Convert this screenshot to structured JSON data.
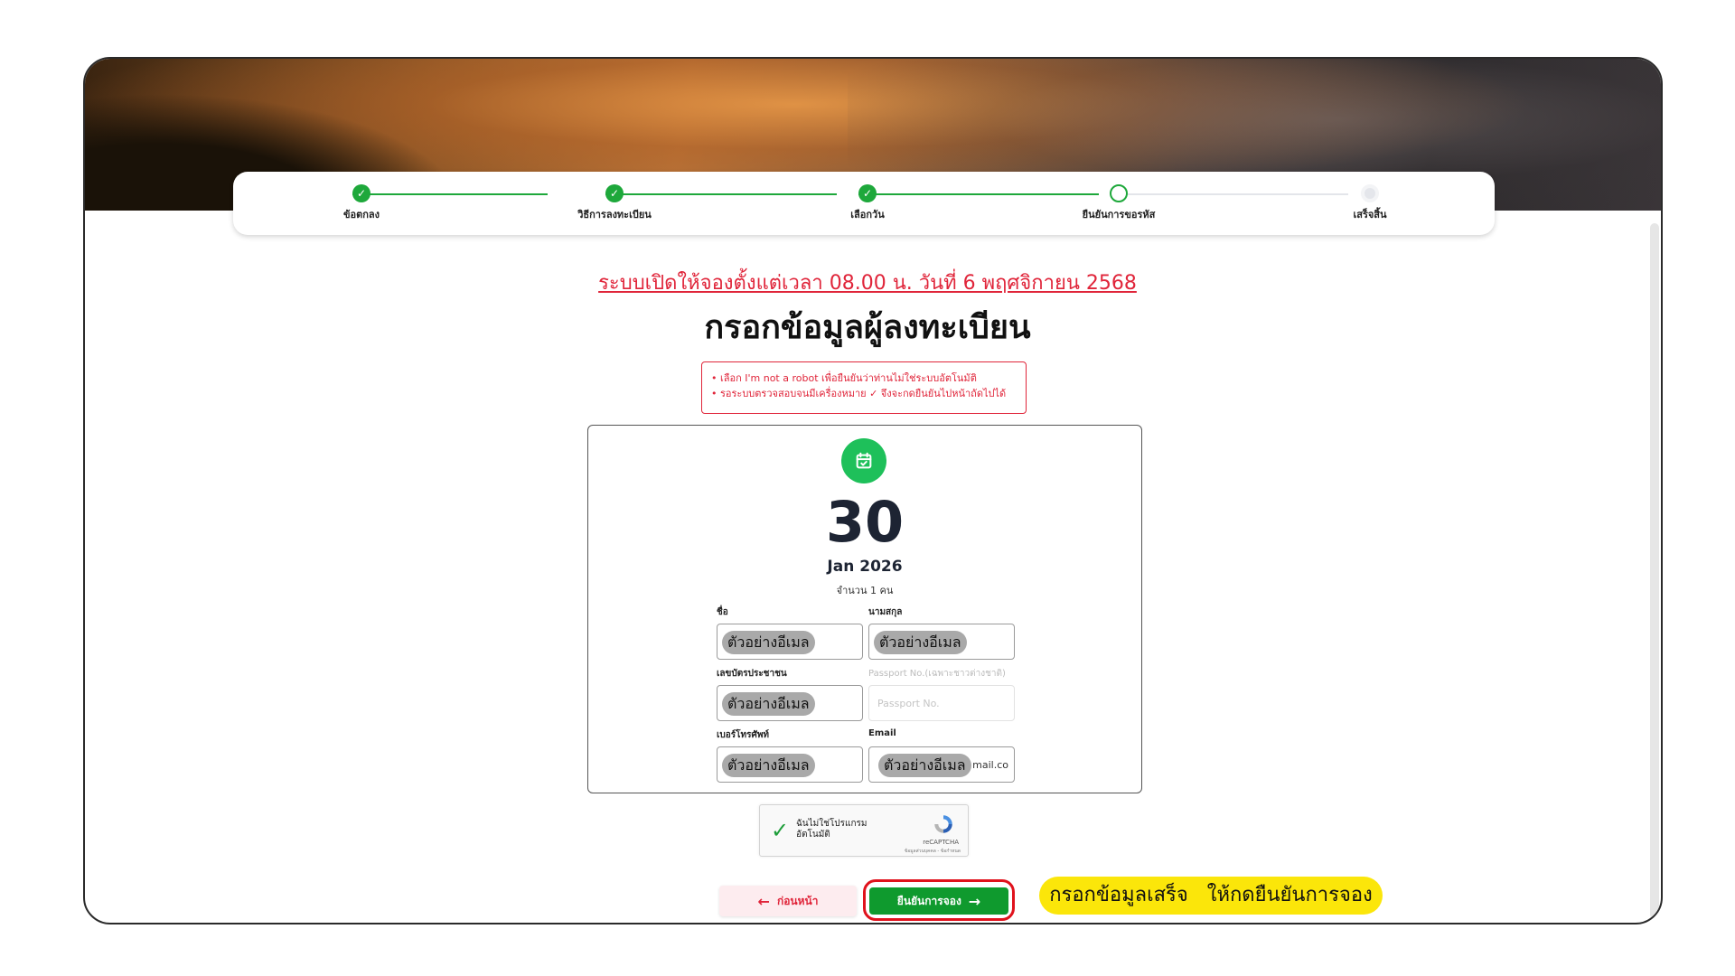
{
  "stepper": {
    "steps": [
      {
        "label": "ข้อตกลง",
        "status": "done"
      },
      {
        "label": "วิธีการลงทะเบียน",
        "status": "done"
      },
      {
        "label": "เลือกวัน",
        "status": "done"
      },
      {
        "label": "ยืนยันการขอรหัส",
        "status": "current"
      },
      {
        "label": "เสร็จสิ้น",
        "status": "pending"
      }
    ]
  },
  "notice": "ระบบเปิดให้จองตั้งแต่เวลา 08.00 น. วันที่ 6 พฤศจิกายน 2568",
  "title": "กรอกข้อมูลผู้ลงทะเบียน",
  "warnings": [
    "• เลือก I'm not a robot เพื่อยืนยันว่าท่านไม่ใช่ระบบอัตโนมัติ",
    "• รอระบบตรวจสอบจนมีเครื่องหมาย ✓ จึงจะกดยืนยันไปหน้าถัดไปได้"
  ],
  "booking": {
    "day": "30",
    "month_year": "Jan 2026",
    "count": "จำนวน 1 คน"
  },
  "form": {
    "first_name": {
      "label": "ชื่อ",
      "value": "ตัวอย่างอีเมล"
    },
    "last_name": {
      "label": "นามสกุล",
      "value": "ตัวอย่างอีเมล"
    },
    "id_card": {
      "label": "เลขบัตรประชาชน",
      "value": "ตัวอย่างอีเมล"
    },
    "passport": {
      "label": "Passport No.(เฉพาะชาวต่างชาติ)",
      "placeholder": "Passport No."
    },
    "phone": {
      "label": "เบอร์โทรศัพท์",
      "value": "ตัวอย่างอีเมล"
    },
    "email": {
      "label": "Email",
      "value": "ตัวอย่างอีเมล",
      "tail": "mail.co"
    }
  },
  "captcha": {
    "label_line1": "ฉันไม่ใช่โปรแกรม",
    "label_line2": "อัตโนมัติ",
    "brand": "reCAPTCHA",
    "terms": "ข้อมูลส่วนบุคคล - ข้อกำหนด"
  },
  "buttons": {
    "back": "ก่อนหน้า",
    "confirm": "ยืนยันการจอง"
  },
  "callout": "กรอกข้อมูลเสร็จ   ให้กดยืนยันการจอง",
  "colors": {
    "accent_green": "#1ea83b",
    "alert_red": "#e0253a",
    "callout_yellow": "#fbe60a"
  }
}
